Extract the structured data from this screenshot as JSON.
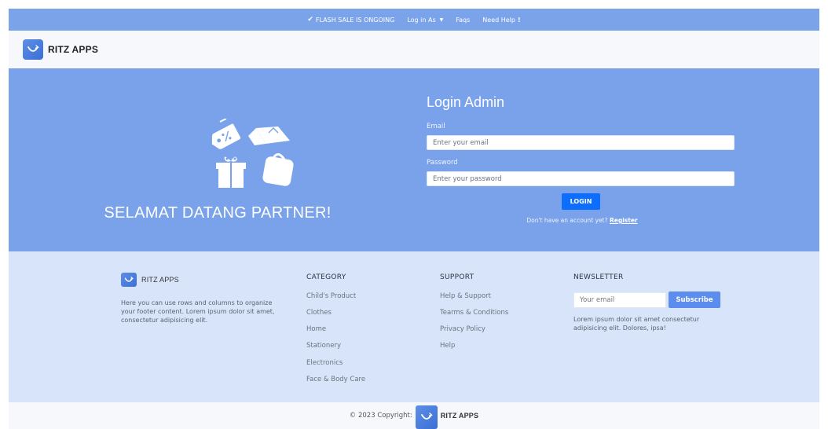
{
  "topbar": {
    "flash_sale": "FLASH SALE IS ONGOING",
    "login_as": "Log in As",
    "faqs": "Faqs",
    "need_help": "Need Help",
    "need_help_mark": "!"
  },
  "brand": {
    "name": "RITZ APPS"
  },
  "hero": {
    "welcome": "SELAMAT DATANG PARTNER!",
    "login_title": "Login Admin",
    "email_label": "Email",
    "email_placeholder": "Enter your email",
    "password_label": "Password",
    "password_placeholder": "Enter your password",
    "login_button": "LOGIN",
    "signup_text": "Don't have an account yet?",
    "register_link": "Register"
  },
  "footer": {
    "brand": "RITZ APPS",
    "description": "Here you can use rows and columns to organize your footer content. Lorem ipsum dolor sit amet, consectetur adipisicing elit.",
    "category": {
      "heading": "CATEGORY",
      "items": [
        "Child's Product",
        "Clothes",
        "Home",
        "Stationery",
        "Electronics",
        "Face & Body Care"
      ]
    },
    "support": {
      "heading": "SUPPORT",
      "items": [
        "Help & Support",
        "Tearms & Conditions",
        "Privacy Policy",
        "Help"
      ]
    },
    "newsletter": {
      "heading": "NEWSLETTER",
      "placeholder": "Your email",
      "button": "Subscribe",
      "description": "Lorem ipsum dolor sit amet consectetur adipisicing elit. Dolores, ipsa!"
    }
  },
  "copyright": {
    "text": "© 2023 Copyright:",
    "brand": "RITZ APPS"
  },
  "colors": {
    "topbar": "#7ba3ea",
    "hero": "#79a2eb",
    "footer": "#d7e4fa",
    "login_button": "#0d6efd",
    "subscribe_button": "#5b8def"
  }
}
